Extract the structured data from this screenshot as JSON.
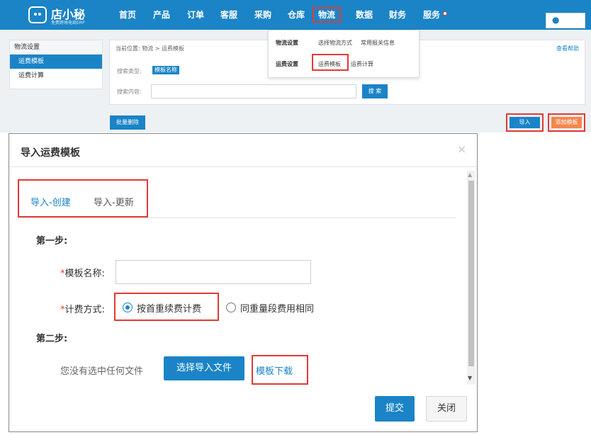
{
  "app": {
    "logo_name": "店小秘",
    "logo_tagline": "免费跨境电商ERP"
  },
  "nav": {
    "items": [
      "首页",
      "产品",
      "订单",
      "客服",
      "采购",
      "仓库",
      "物流",
      "数据",
      "财务",
      "服务"
    ],
    "active": "物流"
  },
  "dropdown": {
    "row1_label": "物流设置",
    "row1_links": [
      "选择物流方式",
      "常用报关信息"
    ],
    "row2_label": "运费设置",
    "row2_links": [
      "运费模板",
      "运费计算"
    ]
  },
  "sidebar": {
    "header": "物流设置",
    "items": [
      "运费模板",
      "运费计算"
    ]
  },
  "main": {
    "breadcrumb": "当前位置: 物流 > 运费模板",
    "help": "查看帮助",
    "search_type_label": "搜索类型:",
    "search_type_value": "模板名称",
    "search_content_label": "搜索内容:",
    "search_button": "搜 索",
    "batch_delete": "批量删除",
    "import_button": "导入",
    "add_button": "添加模板"
  },
  "modal": {
    "title": "导入运费模板",
    "close_glyph": "×",
    "tabs": [
      "导入-创建",
      "导入-更新"
    ],
    "step1": "第一步:",
    "required_mark": "*",
    "template_name_label": "模板名称:",
    "billing_label": "计费方式:",
    "option_first_weight": "按首重续费计费",
    "option_same_weight": "同重量段费用相同",
    "step2": "第二步:",
    "no_file_text": "您没有选中任何文件",
    "choose_file_button": "选择导入文件",
    "download_template": "模板下载",
    "submit": "提交",
    "close": "关闭"
  }
}
